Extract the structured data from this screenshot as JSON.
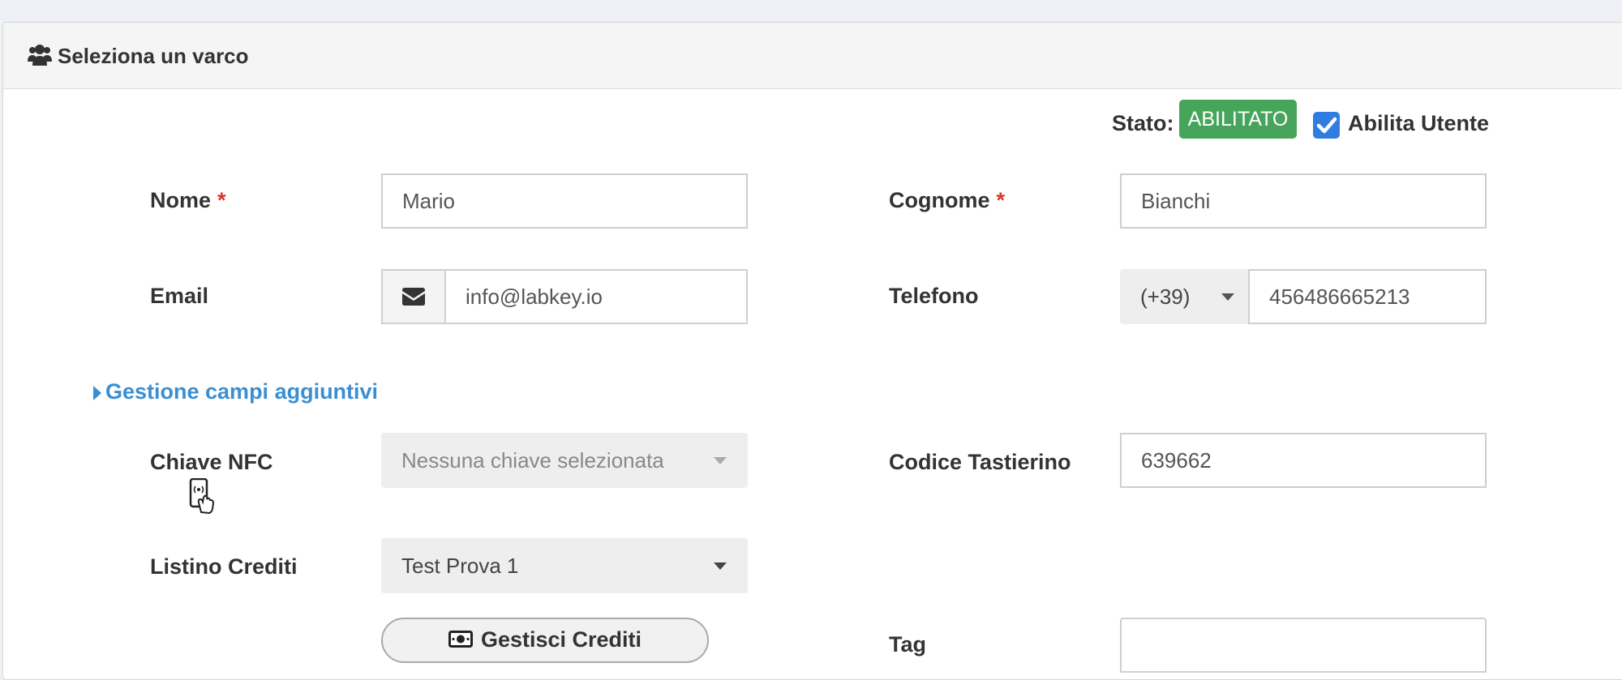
{
  "panel": {
    "title": "Seleziona un varco",
    "title_icon": "users-icon"
  },
  "status": {
    "label": "Stato:",
    "badge": "ABILITATO",
    "badge_color": "#46a55b",
    "enable_label": "Abilita Utente",
    "enable_checked": true
  },
  "form": {
    "nome": {
      "label": "Nome",
      "required": "*",
      "value": "Mario"
    },
    "cognome": {
      "label": "Cognome",
      "required": "*",
      "value": "Bianchi"
    },
    "email": {
      "label": "Email",
      "value": "info@labkey.io",
      "icon": "envelope-icon"
    },
    "telefono": {
      "label": "Telefono",
      "prefix": "(+39)",
      "value": "456486665213"
    },
    "extra_fields_link": "Gestione campi aggiuntivi",
    "chiave_nfc": {
      "label": "Chiave NFC",
      "placeholder": "Nessuna chiave selezionata",
      "icon": "nfc-tap-icon"
    },
    "codice_tastierino": {
      "label": "Codice Tastierino",
      "value": "639662"
    },
    "listino_crediti": {
      "label": "Listino Crediti",
      "value": "Test Prova 1"
    },
    "gestisci_crediti": {
      "label": "Gestisci Crediti",
      "icon": "money-bill-icon"
    },
    "tag": {
      "label": "Tag",
      "value": ""
    }
  },
  "colors": {
    "accent_link": "#3a8fd3",
    "required": "#d9342b",
    "checkbox": "#2f7de1"
  }
}
